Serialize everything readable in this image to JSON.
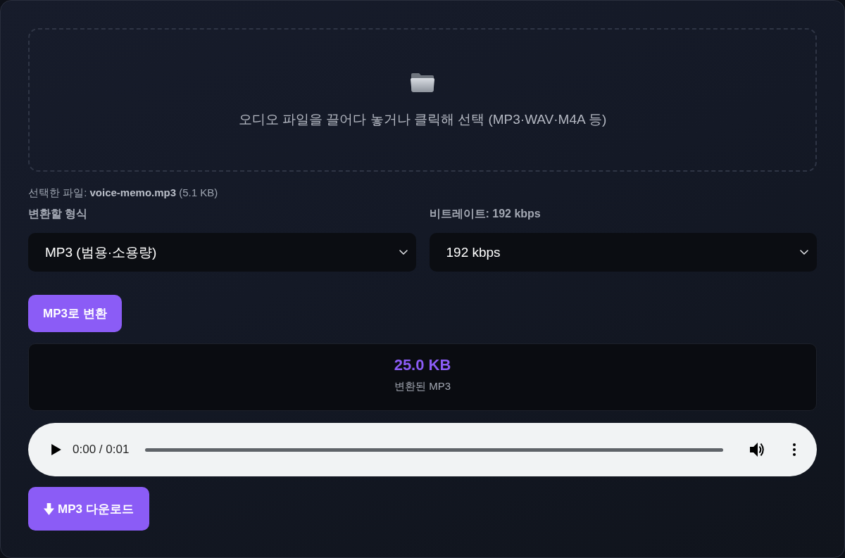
{
  "dropzone": {
    "prompt": "오디오 파일을 끌어다 놓거나 클릭해 선택 (MP3·WAV·M4A 등)"
  },
  "selected_file": "선택한 파일: **voice-memo.mp3** (5.1 KB)",
  "format": {
    "label": "변환할 형식",
    "value": "MP3 (범용·소용량)"
  },
  "bitrate": {
    "label": "비트레이트: 192 kbps",
    "value": "192 kbps"
  },
  "convert_button": "MP3로 변환",
  "result": {
    "size": "25.0 KB",
    "caption": "변환된 MP3"
  },
  "audio_player": {
    "time": "0:00 / 0:01"
  },
  "download_button": "MP3 다운로드"
}
